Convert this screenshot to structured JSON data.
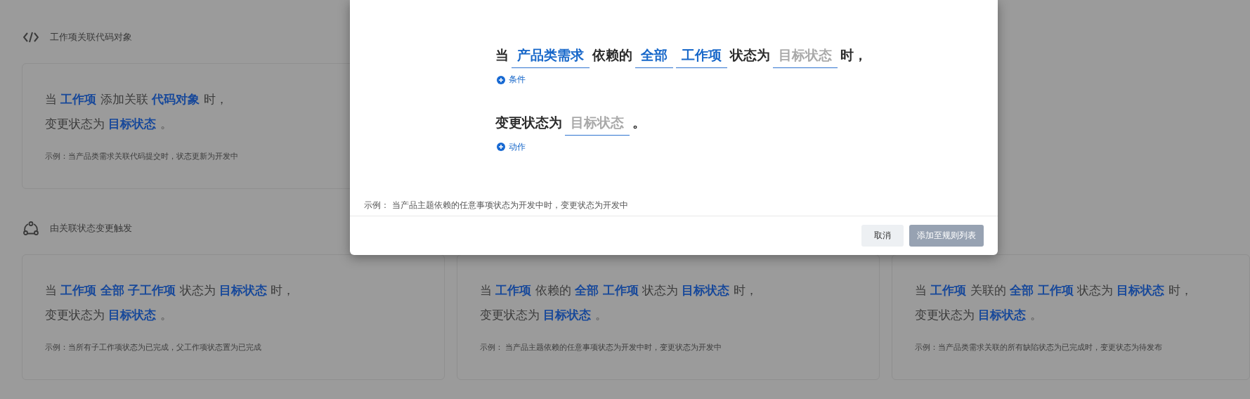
{
  "sections": [
    {
      "title": "工作项关联代码对象",
      "cards": [
        {
          "condition": [
            {
              "kind": "text",
              "text": "当"
            },
            {
              "kind": "token",
              "text": "工作项"
            },
            {
              "kind": "text",
              "text": "添加关联"
            },
            {
              "kind": "token",
              "text": "代码对象"
            },
            {
              "kind": "text",
              "text": "时，"
            }
          ],
          "action": [
            {
              "kind": "text",
              "text": "变更状态为"
            },
            {
              "kind": "token",
              "text": "目标状态"
            },
            {
              "kind": "text",
              "text": "。"
            }
          ],
          "example": "示例：当产品类需求关联代码提交时，状态更新为开发中"
        }
      ]
    },
    {
      "title": "由关联状态变更触发",
      "cards": [
        {
          "condition": [
            {
              "kind": "text",
              "text": "当"
            },
            {
              "kind": "token",
              "text": "工作项"
            },
            {
              "kind": "token",
              "text": "全部"
            },
            {
              "kind": "token",
              "text": "子工作项"
            },
            {
              "kind": "text",
              "text": "状态为"
            },
            {
              "kind": "token",
              "text": "目标状态"
            },
            {
              "kind": "text",
              "text": "时，"
            }
          ],
          "action": [
            {
              "kind": "text",
              "text": "变更状态为"
            },
            {
              "kind": "token",
              "text": "目标状态"
            },
            {
              "kind": "text",
              "text": "。"
            }
          ],
          "example": "示例：当所有子工作项状态为已完成，父工作项状态置为已完成"
        },
        {
          "condition": [
            {
              "kind": "text",
              "text": "当"
            },
            {
              "kind": "token",
              "text": "工作项"
            },
            {
              "kind": "text",
              "text": "依赖的"
            },
            {
              "kind": "token",
              "text": "全部"
            },
            {
              "kind": "token",
              "text": "工作项"
            },
            {
              "kind": "text",
              "text": "状态为"
            },
            {
              "kind": "token",
              "text": "目标状态"
            },
            {
              "kind": "text",
              "text": "时，"
            }
          ],
          "action": [
            {
              "kind": "text",
              "text": "变更状态为"
            },
            {
              "kind": "token",
              "text": "目标状态"
            },
            {
              "kind": "text",
              "text": "。"
            }
          ],
          "example": "示例： 当产品主题依赖的任意事项状态为开发中时，变更状态为开发中"
        },
        {
          "condition": [
            {
              "kind": "text",
              "text": "当"
            },
            {
              "kind": "token",
              "text": "工作项"
            },
            {
              "kind": "text",
              "text": "关联的"
            },
            {
              "kind": "token",
              "text": "全部"
            },
            {
              "kind": "token",
              "text": "工作项"
            },
            {
              "kind": "text",
              "text": "状态为"
            },
            {
              "kind": "token",
              "text": "目标状态"
            },
            {
              "kind": "text",
              "text": "时，"
            }
          ],
          "action": [
            {
              "kind": "text",
              "text": "变更状态为"
            },
            {
              "kind": "token",
              "text": "目标状态"
            },
            {
              "kind": "text",
              "text": "。"
            }
          ],
          "example": "示例：当产品类需求关联的所有缺陷状态为已完成时，变更状态为待发布"
        }
      ]
    }
  ],
  "modal": {
    "condition": [
      {
        "kind": "text",
        "text": "当"
      },
      {
        "kind": "select",
        "value": "产品类需求"
      },
      {
        "kind": "text",
        "text": "依赖的"
      },
      {
        "kind": "select",
        "value": "全部"
      },
      {
        "kind": "select",
        "value": "工作项"
      },
      {
        "kind": "text",
        "text": "状态为"
      },
      {
        "kind": "select",
        "placeholder": "目标状态"
      },
      {
        "kind": "text",
        "text": "时，"
      }
    ],
    "add_condition": "条件",
    "action": [
      {
        "kind": "text",
        "text": "变更状态为"
      },
      {
        "kind": "select",
        "placeholder": "目标状态"
      },
      {
        "kind": "text",
        "text": "。"
      }
    ],
    "add_action": "动作",
    "example": "示例：  当产品主题依赖的任意事项状态为开发中时，变更状态为开发中",
    "buttons": [
      {
        "label": "取消",
        "kind": "secondary",
        "disabled": false
      },
      {
        "label": "添加至规则列表",
        "kind": "primary",
        "disabled": true
      }
    ]
  }
}
